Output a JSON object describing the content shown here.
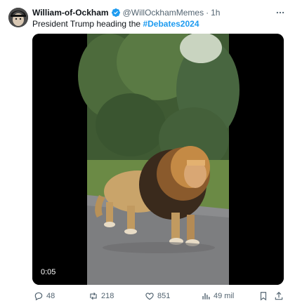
{
  "author": {
    "display_name": "William-of-Ockham",
    "handle": "@WillOckhamMemes",
    "separator": "·",
    "timestamp": "1h",
    "verified": true,
    "verified_color": "#1d9bf0"
  },
  "tweet": {
    "text": "President Trump heading the ",
    "hashtag": "#Debates2024"
  },
  "media": {
    "type": "video",
    "duration": "0:05"
  },
  "actions": {
    "replies": "48",
    "retweets": "218",
    "likes": "851",
    "views": "49 mil"
  },
  "icons": {
    "more": "more-dots-icon",
    "reply": "reply-icon",
    "retweet": "retweet-icon",
    "like": "heart-icon",
    "views": "views-chart-icon",
    "bookmark": "bookmark-icon",
    "share": "share-icon"
  },
  "colors": {
    "text_primary": "#0f1419",
    "text_secondary": "#536471",
    "accent": "#1d9bf0"
  }
}
